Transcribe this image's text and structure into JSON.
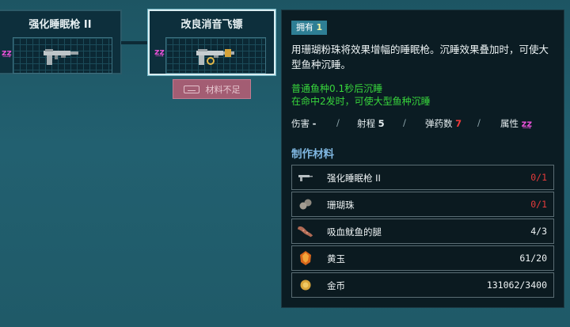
{
  "tree": {
    "node_left": {
      "title": "强化睡眠枪 II"
    },
    "node_selected": {
      "title": "改良消音飞镖"
    },
    "insufficient_label": "材料不足",
    "sleep_glyph": "z͢z"
  },
  "info": {
    "owned_label": "拥有",
    "owned_count": "1",
    "description": "用珊瑚粉珠将效果增幅的睡眠枪。沉睡效果叠加时，可使大型鱼种沉睡。",
    "effect_line1": "普通鱼种0.1秒后沉睡",
    "effect_line2": "在命中2发时，可使大型鱼种沉睡",
    "stats": {
      "damage_label": "伤害",
      "damage_value": "-",
      "range_label": "射程",
      "range_value": "5",
      "ammo_label": "弹药数",
      "ammo_value": "7",
      "attr_label": "属性",
      "attr_value": "z͢z"
    },
    "materials_title": "制作材料",
    "materials": [
      {
        "name": "强化睡眠枪 II",
        "count": "0/1",
        "icon": "gun-icon",
        "short": true
      },
      {
        "name": "珊瑚珠",
        "count": "0/1",
        "icon": "pearls-icon",
        "short": true
      },
      {
        "name": "吸血鱿鱼的腿",
        "count": "4/3",
        "icon": "squid-leg-icon",
        "short": false
      },
      {
        "name": "黄玉",
        "count": "61/20",
        "icon": "topaz-icon",
        "short": false
      },
      {
        "name": "金币",
        "count": "131062/3400",
        "icon": "coin-icon",
        "short": false
      }
    ]
  },
  "colors": {
    "accent": "#2e7e94",
    "effect_green": "#38d63c",
    "shortage_red": "#e53b3b",
    "sleep_pink": "#e14fd2"
  }
}
